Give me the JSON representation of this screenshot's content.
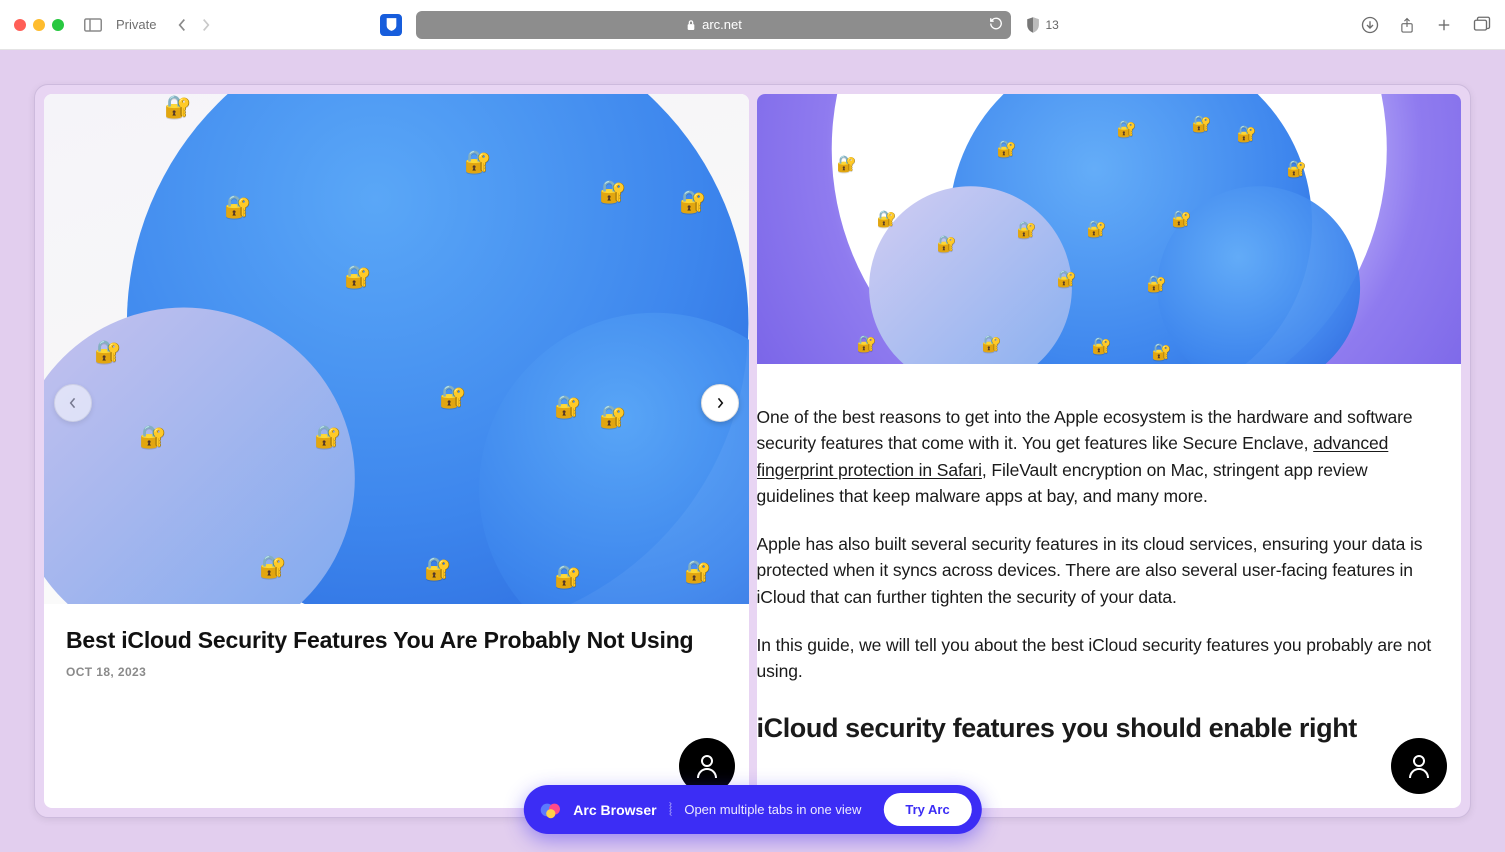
{
  "toolbar": {
    "private_label": "Private",
    "url_display": "arc.net",
    "shield_count": "13"
  },
  "left_pane": {
    "headline": "Best iCloud Security Features You Are Probably Not Using",
    "date": "OCT 18, 2023"
  },
  "article": {
    "para1_pre": "One of the best reasons to get into the Apple ecosystem is the hardware and software security features that come with it. You get features like Secure Enclave, ",
    "para1_link": "advanced fingerprint protection in Safari",
    "para1_post": ", FileVault encryption on Mac, stringent app review guidelines that keep malware apps at bay, and many more.",
    "para2": "Apple has also built several security features in its cloud services, ensuring your data is protected when it syncs across devices. There are also several user-facing features in iCloud that can further tighten the security of your data.",
    "para3": "In this guide, we will tell you about the best iCloud security features you probably are not using.",
    "heading2": "iCloud security features you should enable right"
  },
  "pill": {
    "brand": "Arc Browser",
    "tagline": "Open multiple tabs in one view",
    "cta": "Try Arc"
  }
}
